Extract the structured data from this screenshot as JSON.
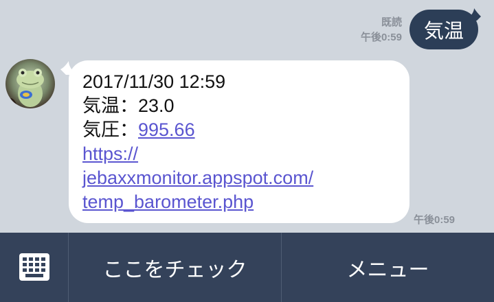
{
  "outgoing": {
    "text": "気温",
    "read_label": "既読",
    "time": "午後0:59"
  },
  "incoming": {
    "lines": [
      "2017/11/30 12:59",
      "気温：23.0",
      "気圧：",
      "995.66",
      "https://",
      "jebaxxmonitor.appspot.com/",
      "temp_barometer.php"
    ],
    "time": "午後0:59",
    "avatar_icon": "frog-avatar-icon"
  },
  "menu_bar": {
    "keyboard_icon": "keyboard-icon",
    "items": [
      "ここをチェック",
      "メニュー"
    ]
  },
  "colors": {
    "chat_background": "#d0d6dd",
    "outgoing_bubble": "#2c3e57",
    "incoming_bubble": "#ffffff",
    "link": "#5a55d0",
    "menu_bar": "#34425a",
    "meta_text": "#8a9099"
  }
}
